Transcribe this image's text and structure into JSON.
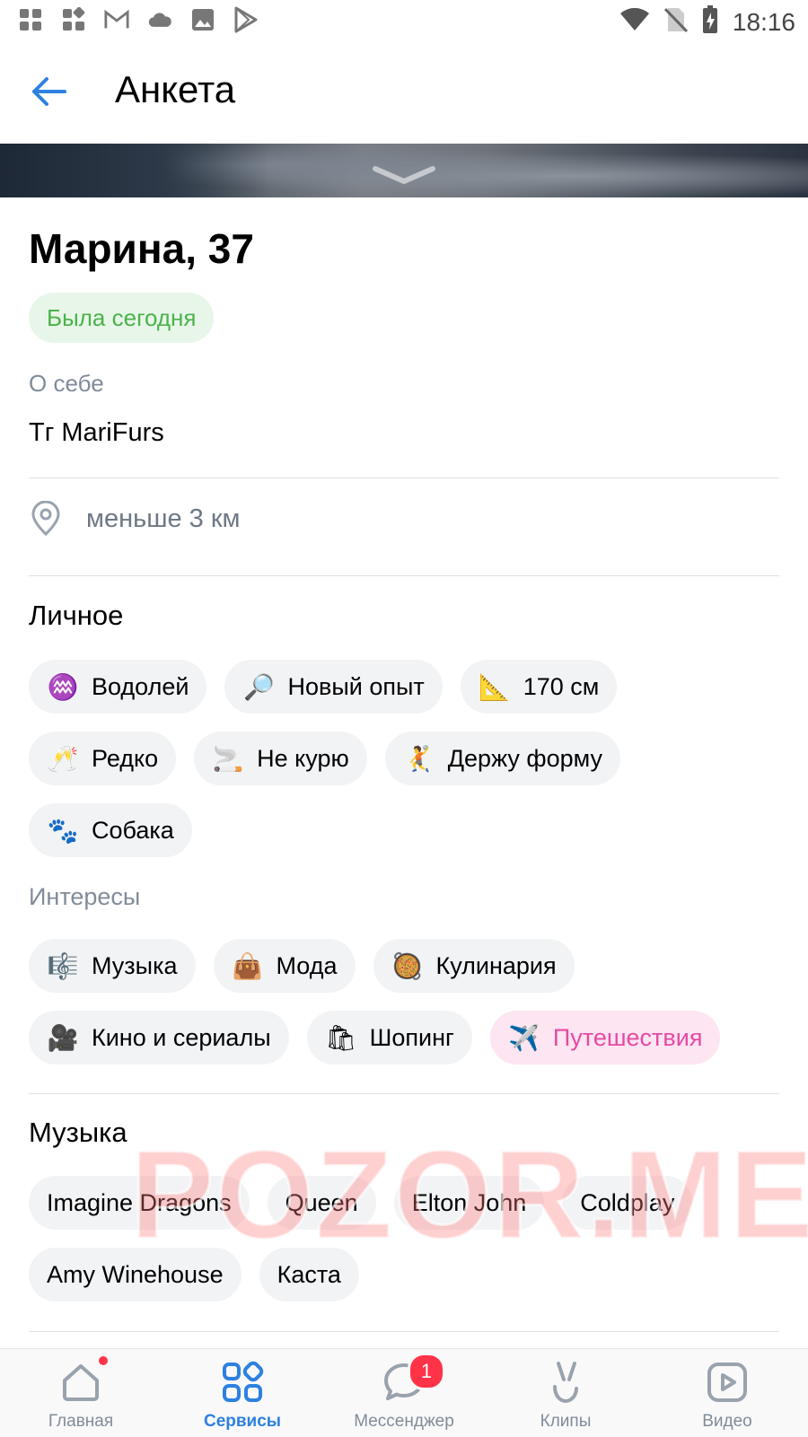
{
  "status_bar": {
    "time": "18:16",
    "left_icons": [
      "apps-icon",
      "widgets-icon",
      "gmail-icon",
      "cloud-icon",
      "image-icon",
      "play-store-icon"
    ],
    "right_icons": [
      "wifi-icon",
      "no-sim-icon",
      "battery-icon"
    ]
  },
  "header": {
    "title": "Анкета",
    "back_icon": "arrow-left-icon"
  },
  "profile": {
    "name": "Марина, 37",
    "status": "Была сегодня",
    "about_label": "О себе",
    "about_text": "Тг MariFurs",
    "location": "меньше 3 км"
  },
  "personal": {
    "title": "Личное",
    "chips": [
      {
        "icon": "aquarius-icon",
        "emoji": "♒",
        "label": "Водолей"
      },
      {
        "icon": "magnifier-icon",
        "emoji": "🔎",
        "label": "Новый опыт"
      },
      {
        "icon": "ruler-icon",
        "emoji": "📐",
        "label": "170 см"
      },
      {
        "icon": "champagne-icon",
        "emoji": "🥂",
        "label": "Редко"
      },
      {
        "icon": "cigarette-icon",
        "emoji": "🚬",
        "label": "Не курю"
      },
      {
        "icon": "sport-icon",
        "emoji": "🤾",
        "label": "Держу форму"
      },
      {
        "icon": "paw-icon",
        "emoji": "🐾",
        "label": "Собака"
      }
    ]
  },
  "interests": {
    "title": "Интересы",
    "chips": [
      {
        "icon": "music-icon",
        "emoji": "🎼",
        "label": "Музыка",
        "active": false
      },
      {
        "icon": "handbag-icon",
        "emoji": "👜",
        "label": "Мода",
        "active": false
      },
      {
        "icon": "cooking-icon",
        "emoji": "🥘",
        "label": "Кулинария",
        "active": false
      },
      {
        "icon": "movie-camera-icon",
        "emoji": "🎥",
        "label": "Кино и сериалы",
        "active": false
      },
      {
        "icon": "shopping-bags-icon",
        "emoji": "🛍",
        "label": "Шопинг",
        "active": false
      },
      {
        "icon": "airplane-icon",
        "emoji": "✈️",
        "label": "Путешествия",
        "active": true
      }
    ]
  },
  "music": {
    "title": "Музыка",
    "chips": [
      "Imagine Dragons",
      "Queen",
      "Elton John",
      "Coldplay",
      "Amy Winehouse",
      "Каста"
    ]
  },
  "watermark": "POZOR.ME",
  "nav": {
    "items": [
      {
        "label": "Главная",
        "icon": "home-icon",
        "active": false,
        "dot": true
      },
      {
        "label": "Сервисы",
        "icon": "services-icon",
        "active": true
      },
      {
        "label": "Мессенджер",
        "icon": "messenger-icon",
        "active": false,
        "badge": "1"
      },
      {
        "label": "Клипы",
        "icon": "clips-icon",
        "active": false
      },
      {
        "label": "Видео",
        "icon": "video-icon",
        "active": false
      }
    ]
  },
  "colors": {
    "accent": "#2d81e0",
    "online_green": "#4bb34b",
    "active_pink": "#e64aa4",
    "chip_bg": "#f2f3f5",
    "secondary_text": "#818c99"
  }
}
